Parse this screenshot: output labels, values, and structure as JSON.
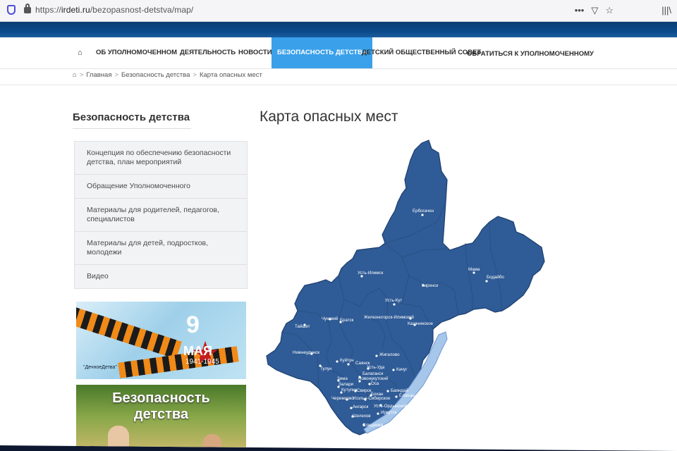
{
  "browser": {
    "url_scheme": "https://",
    "url_host": "irdeti.ru",
    "url_path": "/bezopasnost-detstva/map/",
    "tools_icons": [
      "more-icon",
      "pocket-icon",
      "bookmark-star-icon"
    ],
    "library_icon": "library-icon"
  },
  "nav": {
    "home_icon": "home-icon",
    "items": [
      "ОБ УПОЛНОМОЧЕННОМ",
      "ДЕЯТЕЛЬНОСТЬ",
      "НОВОСТИ",
      "БЕЗОПАСНОСТЬ ДЕТСТВА",
      "ДЕТСКИЙ ОБЩЕСТВЕННЫЙ СОВЕТ",
      "ОБРАТИТЬСЯ К УПОЛНОМОЧЕННОМУ"
    ],
    "active_index": 3
  },
  "breadcrumb": {
    "items": [
      "Главная",
      "Безопасность детства",
      "Карта опасных мест"
    ],
    "separator": ">"
  },
  "sidebar": {
    "title": "Безопасность детства",
    "menu": [
      "Концепция по обеспечению безопасности детства, план мероприятий",
      "Обращение Уполномоченного",
      "Материалы для родителей, педагогов, специалистов",
      "Материалы для детей, подростков, молодежи",
      "Видео"
    ],
    "banner_victory": {
      "day": "9",
      "month": "МАЯ",
      "years": "1941-1945",
      "signature": "\"ДечноеДетва\""
    },
    "banner_safety": {
      "title_line1": "Безопасность",
      "title_line2": "детства"
    }
  },
  "main": {
    "title": "Карта опасных мест",
    "map_labels": [
      "Ербогачен",
      "Мама",
      "Бодайбо",
      "Усть-Илимск",
      "Киренск",
      "Усть-Кут",
      "Чунский",
      "Братск",
      "Железногорск-Илимский",
      "Казачинское",
      "Тайшет",
      "Нижнеудинск",
      "Тулун",
      "Куйтун",
      "Саянск",
      "Жигалово",
      "Усть-Уда",
      "Качуг",
      "Зима",
      "Балаганск",
      "Новонукутский",
      "Залари",
      "Кутулик",
      "Оса",
      "Баяндай",
      "Свирск",
      "Черемхово",
      "Усолье-Сибирское",
      "Бохан",
      "Еланцы",
      "Ангарск",
      "Усть-Ордынский",
      "Иркутск",
      "Шелехов",
      "Слюдянка"
    ],
    "colors": {
      "region": "#2f5b96",
      "lake": "#a6c6ea",
      "accent": "#3aa0ea"
    }
  }
}
